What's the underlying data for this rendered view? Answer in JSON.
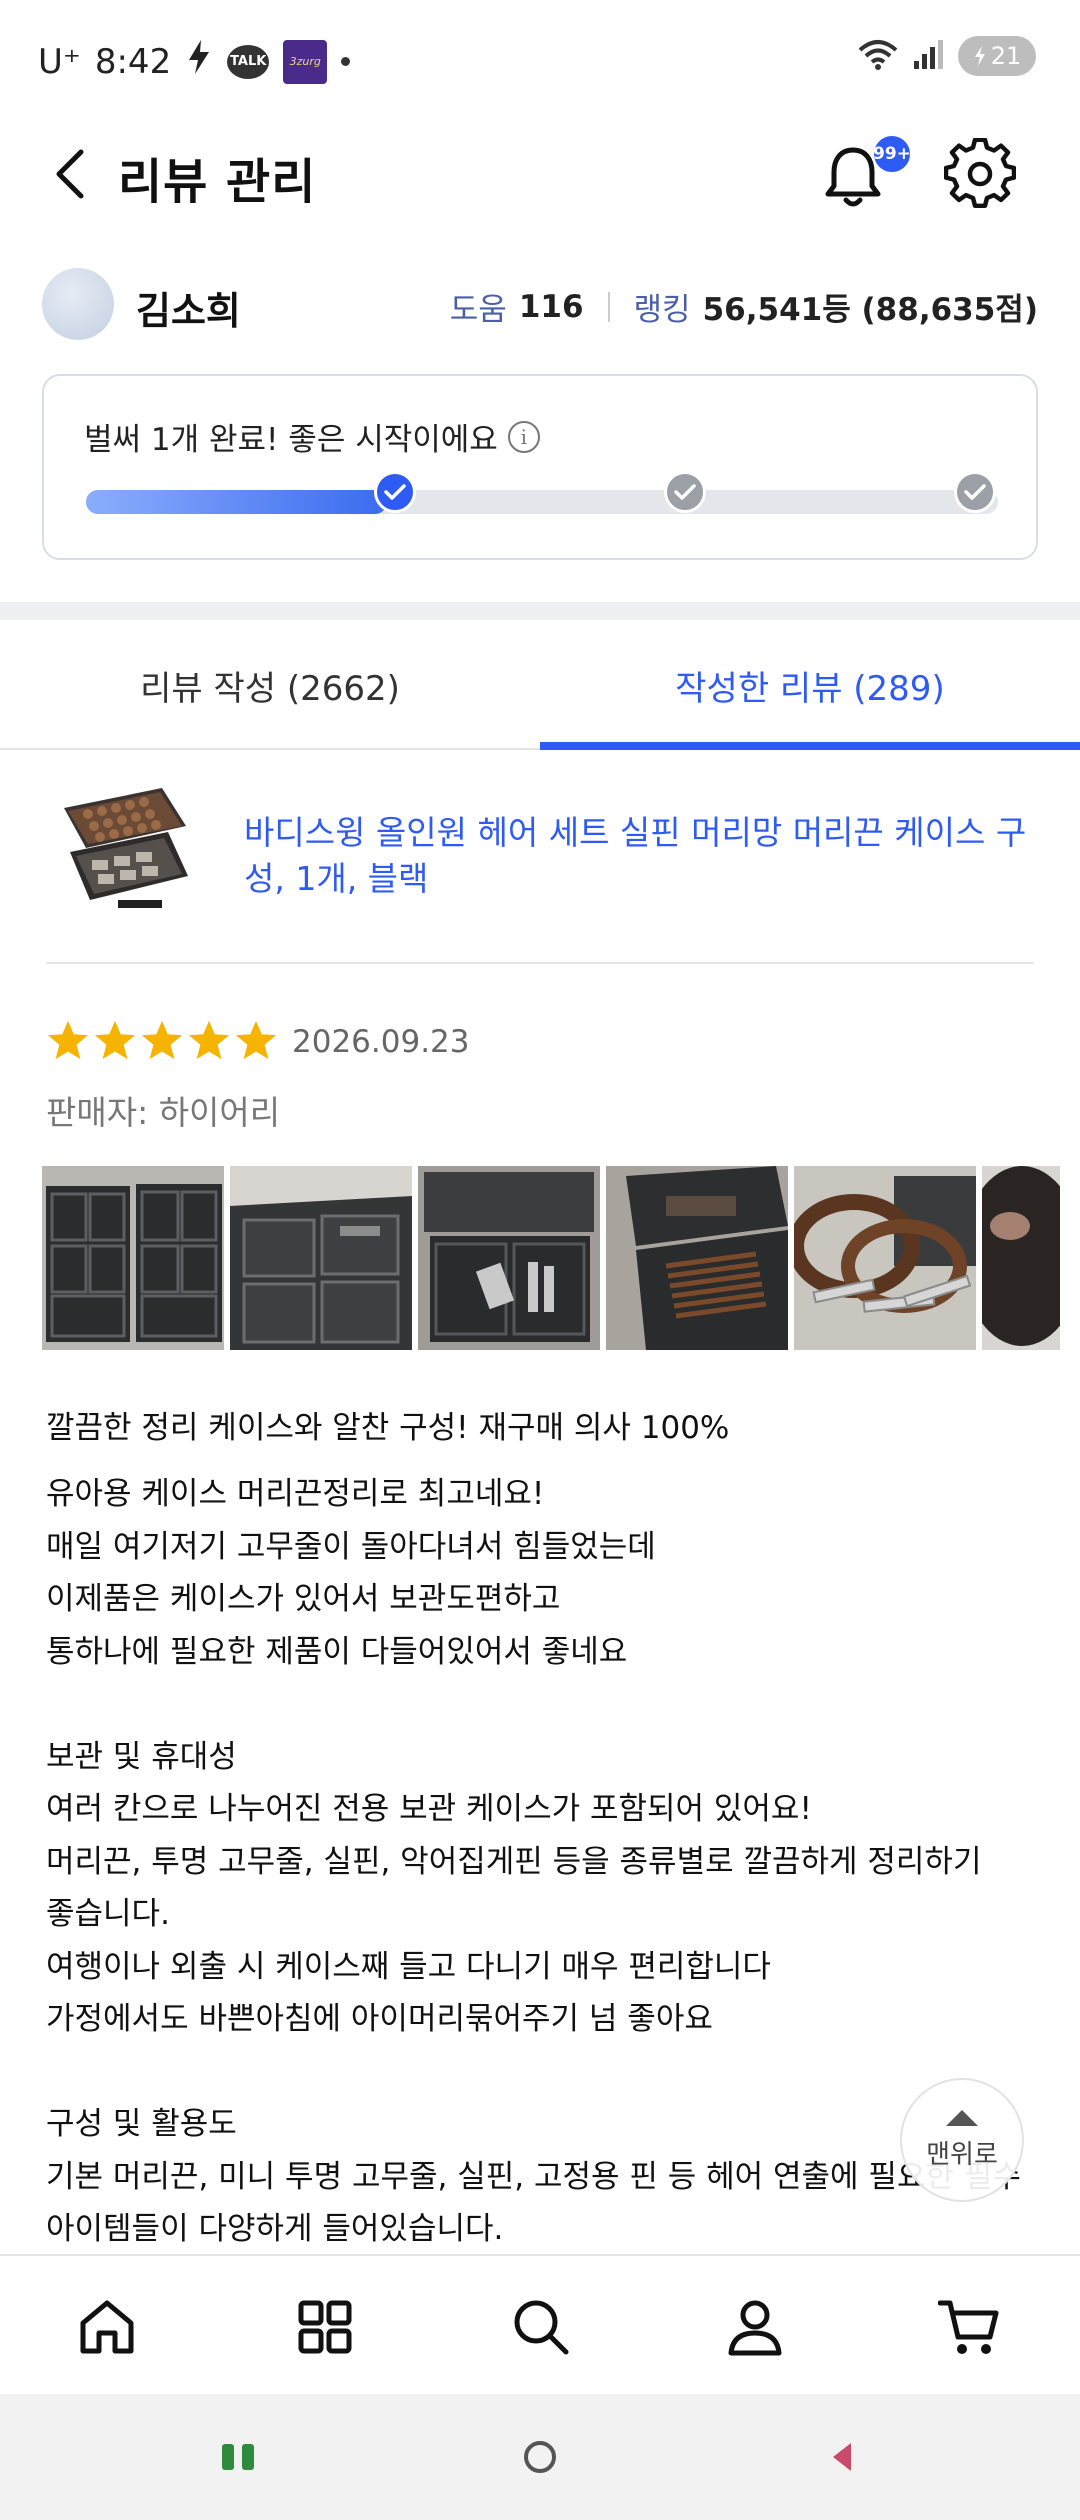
{
  "status_bar": {
    "carrier": "U⁺",
    "time": "8:42",
    "talk_badge": "TALK",
    "app_badge": "3zurg",
    "battery": "21"
  },
  "header": {
    "title": "리뷰 관리",
    "notification_badge": "99+"
  },
  "profile": {
    "name": "김소희",
    "help_label": "도움",
    "help_value": "116",
    "ranking_label": "랭킹",
    "ranking_value": "56,541등 (88,635점)"
  },
  "progress": {
    "message": "벌써 1개 완료! 좋은 시작이에요",
    "completed_steps": 1,
    "total_steps": 3,
    "fill_fraction": 0.33
  },
  "tabs": [
    {
      "label": "리뷰 작성 (2662)",
      "active": false
    },
    {
      "label": "작성한 리뷰 (289)",
      "active": true
    }
  ],
  "product": {
    "title": "바디스윙 올인원 헤어 세트 실핀 머리망 머리끈 케이스 구성, 1개, 블랙"
  },
  "review": {
    "rating": 5,
    "date": "2026.09.23",
    "seller": "판매자: 하이어리",
    "headline": "깔끔한 정리 케이스와 알찬 구성! 재구매 의사 100%",
    "body": [
      "유아용 케이스 머리끈정리로 최고네요!",
      "매일 여기저기 고무줄이 돌아다녀서 힘들었는데",
      "이제품은 케이스가 있어서 보관도편하고",
      "통하나에 필요한 제품이 다들어있어서 좋네요",
      "",
      "보관 및 휴대성",
      "여러 칸으로 나누어진 전용 보관 케이스가 포함되어 있어요!",
      "머리끈, 투명 고무줄, 실핀, 악어집게핀 등을 종류별로 깔끔하게 정리하기",
      "좋습니다.",
      "여행이나 외출 시 케이스째 들고 다니기 매우 편리합니다",
      "가정에서도 바쁜아침에 아이머리묶어주기 넘 좋아요",
      "",
      "구성 및 활용도",
      "기본 머리끈, 미니 투명 고무줄, 실핀, 고정용 핀 등 헤어 연출에 필요한 필수",
      "아이템들이 다양하게 들어있습니다."
    ]
  },
  "scroll_top": {
    "label": "맨위로"
  },
  "colors": {
    "accent": "#2f5bf5",
    "star": "#f6b400",
    "text_muted": "#777777"
  },
  "icons": {
    "bottom_nav": [
      "home-icon",
      "grid-icon",
      "search-icon",
      "person-icon",
      "cart-icon"
    ],
    "system_nav": [
      "recent-apps-icon",
      "home-circle-icon",
      "back-triangle-icon"
    ]
  }
}
